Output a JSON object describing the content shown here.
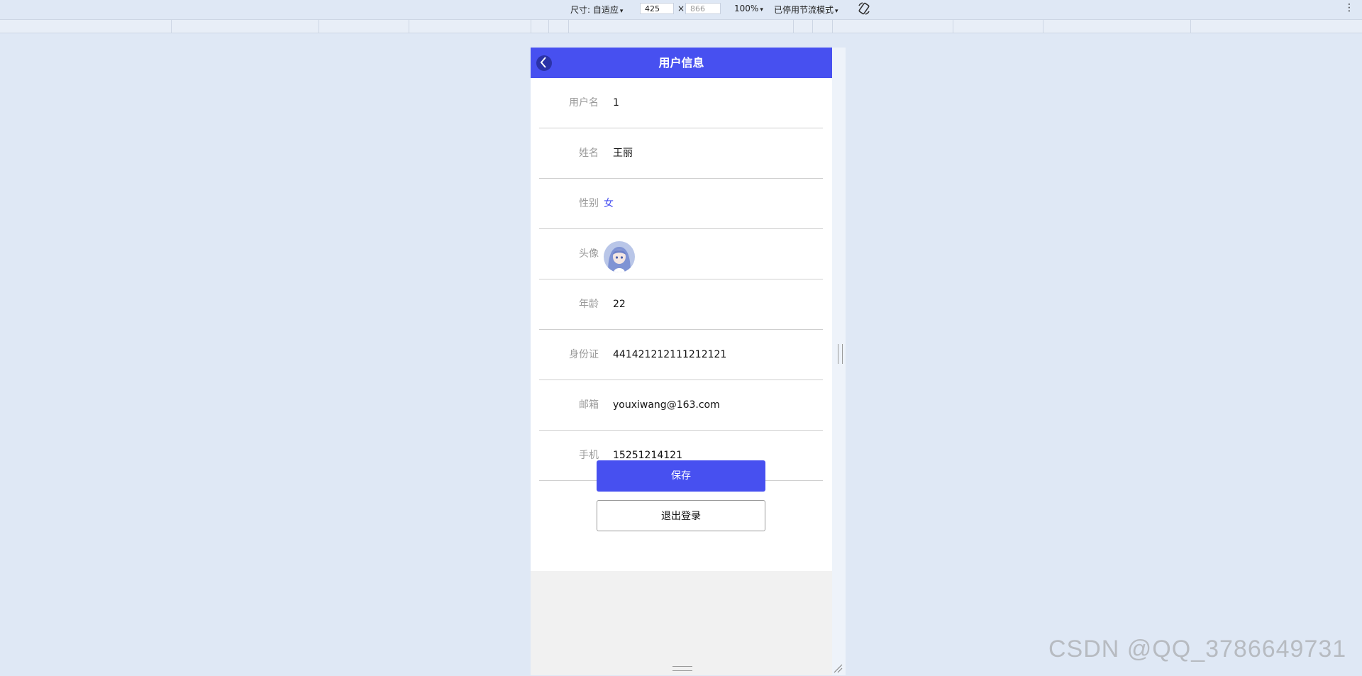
{
  "devtools": {
    "size_label": "尺寸: 自适应",
    "width_value": "425",
    "times_symbol": "×",
    "height_placeholder": "866",
    "zoom": "100%",
    "throttle": "已停用节流模式",
    "caret": "▾",
    "more": "⋮"
  },
  "page": {
    "title": "用户信息",
    "fields": [
      {
        "label": "用户名",
        "value": "1"
      },
      {
        "label": "姓名",
        "value": "王丽"
      },
      {
        "label": "性别",
        "value": "女"
      },
      {
        "label": "头像",
        "value": ""
      },
      {
        "label": "年龄",
        "value": "22"
      },
      {
        "label": "身份证",
        "value": "441421212111212121"
      },
      {
        "label": "邮箱",
        "value": "youxiwang@163.com"
      },
      {
        "label": "手机",
        "value": "15251214121"
      }
    ],
    "save_label": "保存",
    "logout_label": "退出登录"
  },
  "watermark": "CSDN @QQ_3786649731",
  "colors": {
    "accent": "#4750f0",
    "background": "#dfe8f5"
  }
}
